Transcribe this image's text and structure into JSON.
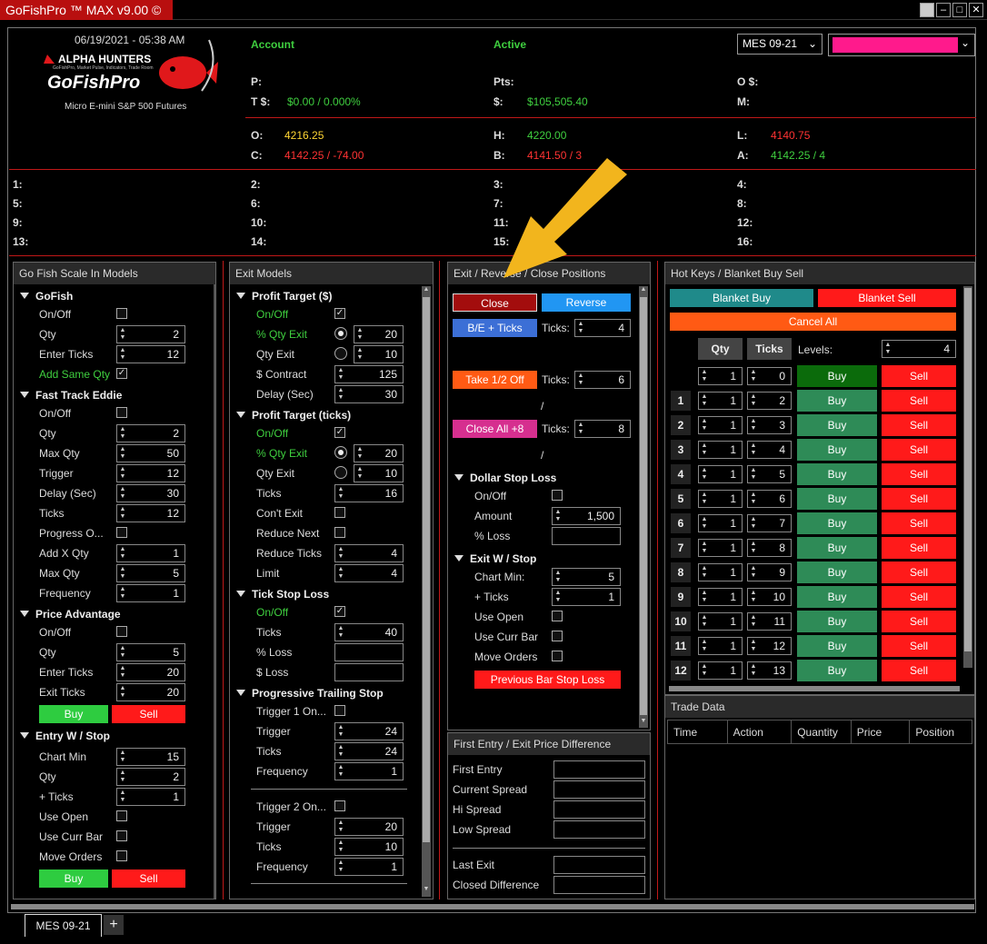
{
  "window": {
    "title": "GoFishPro ™ MAX v9.00 ©"
  },
  "header": {
    "datetime": "06/19/2021 - 05:38 AM",
    "logo_brand": "ALPHA HUNTERS",
    "logo_tagline": "GoFishPro, Market Pulse, Indicators, Trade Room",
    "logo_name": "GoFishPro",
    "subtitle": "Micro E-mini S&P 500 Futures",
    "account_label": "Account",
    "active_label": "Active",
    "instrument": "MES 09-21",
    "account_color": "#ff1a8c",
    "p_label": "P:",
    "pts_label": "Pts:",
    "os_label": "O $:",
    "t_label": "T $:",
    "t_value": "$0.00 / 0.000%",
    "dollar_label": "$:",
    "dollar_value": "$105,505.40",
    "m_label": "M:",
    "o_label": "O:",
    "o_value": "4216.25",
    "h_label": "H:",
    "h_value": "4220.00",
    "l_label": "L:",
    "l_value": "4140.75",
    "c_label": "C:",
    "c_value": "4142.25 / -74.00",
    "b_label": "B:",
    "b_value": "4141.50 / 3",
    "a_label": "A:",
    "a_value": "4142.25 / 4"
  },
  "slots": [
    "1:",
    "2:",
    "3:",
    "4:",
    "5:",
    "6:",
    "7:",
    "8:",
    "9:",
    "10:",
    "11:",
    "12:",
    "13:",
    "14:",
    "15:",
    "16:"
  ],
  "scale_in": {
    "title": "Go Fish Scale In Models",
    "gofish": {
      "title": "GoFish",
      "onoff": "On/Off",
      "qty": "Qty",
      "qty_v": "2",
      "enter_ticks": "Enter Ticks",
      "enter_ticks_v": "12",
      "add_same": "Add Same Qty"
    },
    "fte": {
      "title": "Fast Track Eddie",
      "onoff": "On/Off",
      "qty": "Qty",
      "qty_v": "2",
      "maxqty": "Max Qty",
      "maxqty_v": "50",
      "trigger": "Trigger",
      "trigger_v": "12",
      "delay": "Delay (Sec)",
      "delay_v": "30",
      "ticks": "Ticks",
      "ticks_v": "12",
      "progress": "Progress O...",
      "addx": "Add X Qty",
      "addx_v": "1",
      "maxqty2": "Max Qty",
      "maxqty2_v": "5",
      "freq": "Frequency",
      "freq_v": "1"
    },
    "pa": {
      "title": "Price Advantage",
      "onoff": "On/Off",
      "qty": "Qty",
      "qty_v": "5",
      "enter_ticks": "Enter Ticks",
      "enter_ticks_v": "20",
      "exit_ticks": "Exit Ticks",
      "exit_ticks_v": "20",
      "buy": "Buy",
      "sell": "Sell"
    },
    "ews": {
      "title": "Entry W / Stop",
      "chartmin": "Chart Min",
      "chartmin_v": "15",
      "qty": "Qty",
      "qty_v": "2",
      "plus_ticks": "+ Ticks",
      "plus_ticks_v": "1",
      "useopen": "Use Open",
      "usecurr": "Use Curr Bar",
      "moveorders": "Move Orders",
      "buy": "Buy",
      "sell": "Sell"
    }
  },
  "exit_models": {
    "title": "Exit Models",
    "pt": {
      "title": "Profit Target ($)",
      "onoff": "On/Off",
      "pqty": "% Qty Exit",
      "pqty_v": "20",
      "qtyexit": "Qty Exit",
      "qtyexit_v": "10",
      "contract": "$ Contract",
      "contract_v": "125",
      "delay": "Delay (Sec)",
      "delay_v": "30"
    },
    "ptt": {
      "title": "Profit Target (ticks)",
      "onoff": "On/Off",
      "pqty": "% Qty Exit",
      "pqty_v": "20",
      "qtyexit": "Qty Exit",
      "qtyexit_v": "10",
      "ticks": "Ticks",
      "ticks_v": "16",
      "cont": "Con't Exit",
      "rnext": "Reduce Next",
      "rticks": "Reduce Ticks",
      "rticks_v": "4",
      "limit": "Limit",
      "limit_v": "4"
    },
    "tsl": {
      "title": "Tick Stop Loss",
      "onoff": "On/Off",
      "ticks": "Ticks",
      "ticks_v": "40",
      "ploss": "% Loss",
      "dloss": "$ Loss"
    },
    "pts": {
      "title": "Progressive Trailing Stop",
      "t1": "Trigger 1 On...",
      "trigger": "Trigger",
      "trigger_v": "24",
      "ticks": "Ticks",
      "ticks_v": "24",
      "freq": "Frequency",
      "freq_v": "1",
      "t2": "Trigger 2 On...",
      "trigger2_v": "20",
      "ticks2_v": "10",
      "freq2_v": "1"
    }
  },
  "exit_rev": {
    "title": "Exit / Reverse / Close Positions",
    "close": "Close",
    "reverse": "Reverse",
    "be": "B/E + Ticks",
    "ticks_label": "Ticks:",
    "be_v": "4",
    "half": "Take 1/2 Off",
    "half_v": "6",
    "slash": "/",
    "closeall": "Close All +8",
    "closeall_v": "8",
    "dsl": {
      "title": "Dollar Stop Loss",
      "onoff": "On/Off",
      "amount": "Amount",
      "amount_v": "1,500",
      "ploss": "% Loss"
    },
    "ews": {
      "title": "Exit W / Stop",
      "chartmin": "Chart Min:",
      "chartmin_v": "5",
      "plus_ticks": "+ Ticks",
      "plus_ticks_v": "1",
      "useopen": "Use Open",
      "usecurr": "Use Curr Bar",
      "moveorders": "Move Orders",
      "prevbar": "Previous Bar Stop Loss"
    }
  },
  "first_entry": {
    "title": "First Entry / Exit Price Difference",
    "first": "First Entry",
    "current": "Current Spread",
    "hi": "Hi Spread",
    "low": "Low Spread",
    "last": "Last Exit",
    "closed": "Closed Difference"
  },
  "hotkeys": {
    "title": "Hot Keys / Blanket Buy Sell",
    "bbuy": "Blanket Buy",
    "bsell": "Blanket Sell",
    "cancel": "Cancel All",
    "qty_h": "Qty",
    "ticks_h": "Ticks",
    "levels": "Levels:",
    "levels_v": "4",
    "buy": "Buy",
    "sell": "Sell",
    "rows": [
      {
        "n": "",
        "q": "1",
        "t": "0"
      },
      {
        "n": "1",
        "q": "1",
        "t": "2"
      },
      {
        "n": "2",
        "q": "1",
        "t": "3"
      },
      {
        "n": "3",
        "q": "1",
        "t": "4"
      },
      {
        "n": "4",
        "q": "1",
        "t": "5"
      },
      {
        "n": "5",
        "q": "1",
        "t": "6"
      },
      {
        "n": "6",
        "q": "1",
        "t": "7"
      },
      {
        "n": "7",
        "q": "1",
        "t": "8"
      },
      {
        "n": "8",
        "q": "1",
        "t": "9"
      },
      {
        "n": "9",
        "q": "1",
        "t": "10"
      },
      {
        "n": "10",
        "q": "1",
        "t": "11"
      },
      {
        "n": "11",
        "q": "1",
        "t": "12"
      },
      {
        "n": "12",
        "q": "1",
        "t": "13"
      }
    ]
  },
  "trade_data": {
    "title": "Trade Data",
    "cols": [
      "Time",
      "Action",
      "Quantity",
      "Price",
      "Position"
    ]
  },
  "tabs": {
    "active": "MES 09-21",
    "add": "+"
  }
}
